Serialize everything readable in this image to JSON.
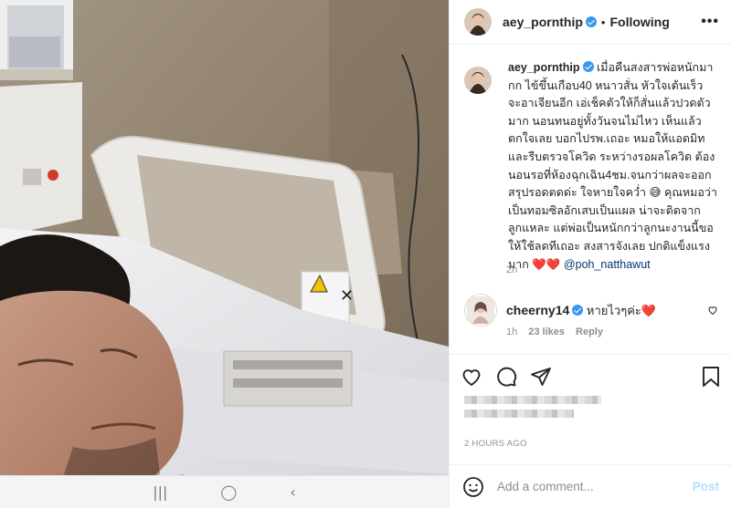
{
  "header": {
    "username": "aey_pornthip",
    "separator": "•",
    "follow_status": "Following",
    "more_glyph": "•••"
  },
  "caption": {
    "username": "aey_pornthip",
    "text": "เมื่อคืนสงสารพ่อหนักมากก ไข้ขึ้นเกือบ40 หนาวสั่น หัวใจเต้นเร็ว จะอาเจียนอีก เอ่เช็คตัวให้ก็สั่นแล้วปวดตัวมาก นอนทนอยู่ทั้งวันจนไม่ไหว เห็นแล้วตกใจเลย บอกไปรพ.เถอะ หมอให้แอดมิท และรีบตรวจโควิด ระหว่างรอผลโควิด ต้องนอนรอที่ห้องฉุกเฉิน4ชม.จนกว่าผลจะออก สรุปรอดตดด่ะ ใจหายใจคว่ำ 😅 คุณหมอว่าเป็นทอมซิลอักเสบเป็นแผล น่าจะติดจากลูกแหละ แต่พ่อเป็นหนักกว่าลูกนะงานนี้ขอให้ใช้ลดทีเถอะ สงสารจังเลย ปกติแข็งแรงมาก ❤️❤️",
    "mention": "@poh_natthawut",
    "time": "2h"
  },
  "comment": {
    "username": "cheerny14",
    "text": "หายไวๆค่ะ❤️",
    "time": "1h",
    "likes": "23 likes",
    "reply": "Reply"
  },
  "post": {
    "time": "2 HOURS AGO"
  },
  "add_comment": {
    "placeholder": "Add a comment...",
    "post_label": "Post"
  },
  "phone_nav": {
    "recents": "|||",
    "home": "◯",
    "back": "‹"
  },
  "icons": {
    "like": "heart-icon",
    "comment": "comment-icon",
    "share": "paper-plane-icon",
    "save": "bookmark-icon",
    "emoji": "smiley-icon"
  },
  "colors": {
    "verified": "#3897f0",
    "mention": "#00376b",
    "post_disabled": "#b2dffc",
    "secondary_text": "#8e8e8e"
  }
}
